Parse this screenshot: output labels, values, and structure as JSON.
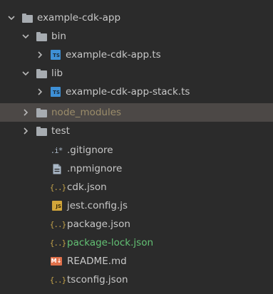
{
  "tree": {
    "items": [
      {
        "label": "example-cdk-app",
        "type": "folder",
        "expanded": true,
        "label_color": "#c8c8c8"
      },
      {
        "label": "bin",
        "type": "folder",
        "expanded": true,
        "label_color": "#c8c8c8"
      },
      {
        "label": "example-cdk-app.ts",
        "type": "ts-file",
        "collapsed": true,
        "badge": "TS",
        "label_color": "#c8c8c8"
      },
      {
        "label": "lib",
        "type": "folder",
        "expanded": true,
        "label_color": "#c8c8c8"
      },
      {
        "label": "example-cdk-app-stack.ts",
        "type": "ts-file",
        "collapsed": true,
        "badge": "TS",
        "label_color": "#c8c8c8"
      },
      {
        "label": "node_modules",
        "type": "folder",
        "collapsed": true,
        "selected": true,
        "label_color": "#9c8d6a"
      },
      {
        "label": "test",
        "type": "folder",
        "collapsed": true,
        "label_color": "#c8c8c8"
      },
      {
        "label": ".gitignore",
        "type": "ignore-file",
        "glyph": ".i*",
        "label_color": "#c8c8c8"
      },
      {
        "label": ".npmignore",
        "type": "text-file",
        "label_color": "#c8c8c8"
      },
      {
        "label": "cdk.json",
        "type": "json-file",
        "glyph": "{..}",
        "label_color": "#c8c8c8"
      },
      {
        "label": "jest.config.js",
        "type": "js-file",
        "badge": "JS",
        "label_color": "#c8c8c8"
      },
      {
        "label": "package.json",
        "type": "json-file",
        "glyph": "{..}",
        "label_color": "#c8c8c8"
      },
      {
        "label": "package-lock.json",
        "type": "json-file",
        "glyph": "{..}",
        "label_color": "#63c174"
      },
      {
        "label": "README.md",
        "type": "md-file",
        "badge": "M↓",
        "label_color": "#c8c8c8"
      },
      {
        "label": "tsconfig.json",
        "type": "json-file",
        "glyph": "{..}",
        "label_color": "#c8c8c8"
      }
    ]
  },
  "colors": {
    "background": "#2b2b2b",
    "selected_row": "#4c4846",
    "folder": "#a7acb1",
    "ts_badge": "#3e90d6",
    "js_badge": "#d2a63a",
    "md_badge": "#e0704a"
  }
}
